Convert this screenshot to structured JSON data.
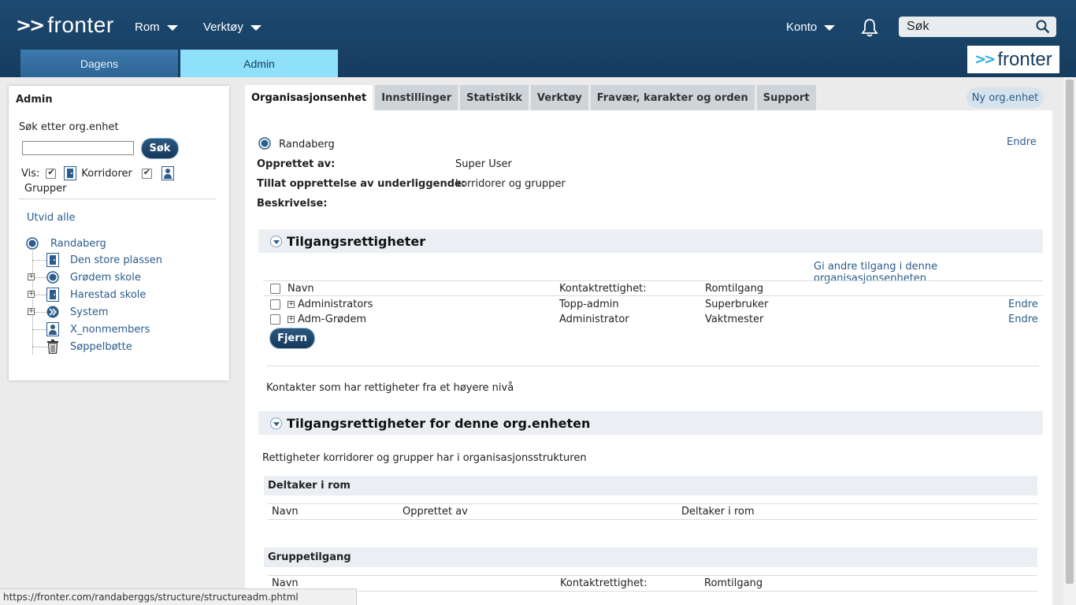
{
  "header": {
    "logo_text": "fronter",
    "logo_arrows": ">>",
    "nav": [
      "Rom",
      "Verktøy"
    ],
    "account": "Konto",
    "search_placeholder": "Søk",
    "tabs": [
      "Dagens",
      "Admin"
    ],
    "right_logo_text": "fronter",
    "right_logo_arrows": ">>"
  },
  "sidebar": {
    "title": "Admin",
    "search_label": "Søk etter org.enhet",
    "search_button": "Søk",
    "vis_label": "Vis:",
    "korridorer_label": "Korridorer",
    "grupper_label": "Grupper",
    "expand_all": "Utvid alle",
    "tree": {
      "root": "Randaberg",
      "children": [
        "Den store plassen",
        "Grødem skole",
        "Harestad skole",
        "System",
        "X_nonmembers",
        "Søppelbøtte"
      ]
    }
  },
  "main_tabs": [
    "Organisasjonsenhet",
    "Innstillinger",
    "Statistikk",
    "Verktøy",
    "Fravær, karakter og orden",
    "Support"
  ],
  "new_org_button": "Ny org.enhet",
  "org": {
    "name": "Randaberg",
    "edit_link": "Endre",
    "created_by_label": "Opprettet av:",
    "created_by_value": "Super User",
    "allow_label": "Tillat opprettelse av underliggende:",
    "allow_value": "korridorer og grupper",
    "description_label": "Beskrivelse:"
  },
  "access": {
    "title": "Tilgangsrettigheter",
    "grant_link": "Gi andre tilgang i denne organisasjonsenheten",
    "columns": [
      "Navn",
      "Kontaktrettighet:",
      "Romtilgang"
    ],
    "rows": [
      {
        "name": "Administrators",
        "contact": "Topp-admin",
        "room": "Superbruker",
        "action": "Endre"
      },
      {
        "name": "Adm-Grødem",
        "contact": "Administrator",
        "room": "Vaktmester",
        "action": "Endre"
      }
    ],
    "remove_button": "Fjern",
    "inherited_text": "Kontakter som har rettigheter fra et høyere nivå"
  },
  "org_access": {
    "title": "Tilgangsrettigheter for denne org.enheten",
    "description": "Rettigheter korridorer og grupper har i organisasjonsstrukturen",
    "participant": {
      "title": "Deltaker i rom",
      "columns": [
        "Navn",
        "Opprettet av",
        "Deltaker i rom"
      ]
    },
    "group": {
      "title": "Gruppetilgang",
      "columns": [
        "Navn",
        "Kontaktrettighet:",
        "Romtilgang"
      ]
    }
  },
  "status_url": "https://fronter.com/randaberggs/structure/structureadm.phtml",
  "colors": {
    "header": "#1d4a72",
    "admin_tab": "#8ee0fb",
    "link": "#2a5c8c"
  }
}
